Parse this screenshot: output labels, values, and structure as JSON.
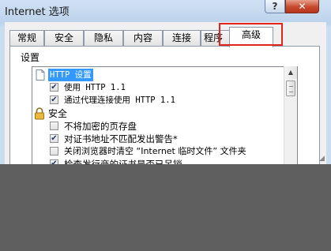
{
  "window": {
    "title": "Internet 选项",
    "help_label": "?",
    "close_label": "✕"
  },
  "tabs": [
    {
      "label": "常规"
    },
    {
      "label": "安全"
    },
    {
      "label": "隐私"
    },
    {
      "label": "内容"
    },
    {
      "label": "连接"
    },
    {
      "label": "程序"
    },
    {
      "label": "高级",
      "active": true
    }
  ],
  "settings": {
    "section_label": "设置",
    "items": [
      {
        "type": "header",
        "icon": "page-icon",
        "label": "HTTP 设置",
        "selected": true
      },
      {
        "type": "checkbox",
        "checked": true,
        "label": "使用 HTTP 1.1"
      },
      {
        "type": "checkbox",
        "checked": true,
        "label": "通过代理连接使用 HTTP 1.1"
      },
      {
        "type": "header",
        "icon": "lock-icon",
        "label": "安全"
      },
      {
        "type": "checkbox",
        "checked": false,
        "label": "不将加密的页存盘"
      },
      {
        "type": "checkbox",
        "checked": true,
        "label": "对证书地址不匹配发出警告*"
      },
      {
        "type": "checkbox",
        "checked": false,
        "label": "关闭浏览器时清空 “Internet 临时文件” 文件夹"
      },
      {
        "type": "checkbox",
        "checked": true,
        "label": "检查发行商的证书是否已吊销"
      }
    ]
  },
  "colors": {
    "highlight_box": "#e0251c",
    "selection": "#3399ff",
    "obscured_area": "#5f5f5f"
  }
}
